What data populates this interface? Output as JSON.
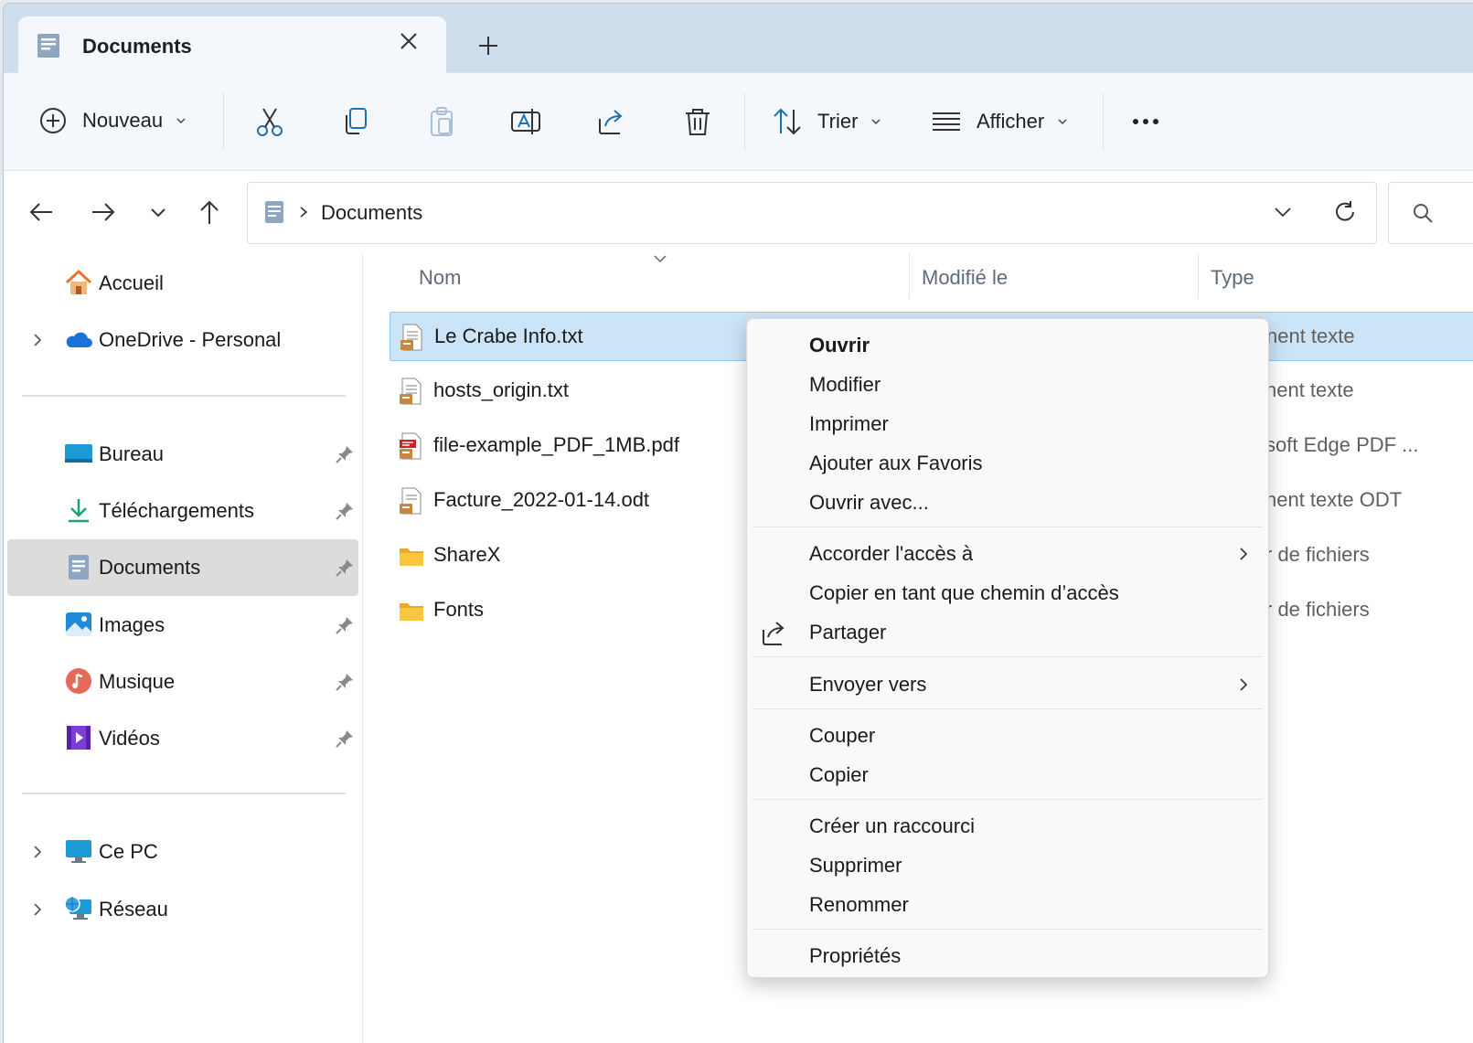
{
  "tab": {
    "title": "Documents"
  },
  "toolbar": {
    "new_label": "Nouveau",
    "sort_label": "Trier",
    "view_label": "Afficher"
  },
  "address": {
    "path": "Documents"
  },
  "sidebar": {
    "home": "Accueil",
    "onedrive": "OneDrive - Personal",
    "quick": [
      {
        "label": "Bureau",
        "icon": "desktop-icon"
      },
      {
        "label": "Téléchargements",
        "icon": "download-icon"
      },
      {
        "label": "Documents",
        "icon": "documents-icon"
      },
      {
        "label": "Images",
        "icon": "pictures-icon"
      },
      {
        "label": "Musique",
        "icon": "music-icon"
      },
      {
        "label": "Vidéos",
        "icon": "videos-icon"
      }
    ],
    "this_pc": "Ce PC",
    "network": "Réseau"
  },
  "columns": {
    "name": "Nom",
    "modified": "Modifié le",
    "type": "Type"
  },
  "files": [
    {
      "name": "Le Crabe Info.txt",
      "type": "nent texte",
      "icon": "text-file-icon"
    },
    {
      "name": "hosts_origin.txt",
      "type": "nent texte",
      "icon": "text-file-icon"
    },
    {
      "name": "file-example_PDF_1MB.pdf",
      "type": "soft Edge PDF ...",
      "icon": "pdf-file-icon"
    },
    {
      "name": "Facture_2022-01-14.odt",
      "type": "nent texte ODT",
      "icon": "odt-file-icon"
    },
    {
      "name": "ShareX",
      "type": "r de fichiers",
      "icon": "folder-icon"
    },
    {
      "name": "Fonts",
      "type": "r de fichiers",
      "icon": "folder-icon"
    }
  ],
  "context_menu": {
    "open": "Ouvrir",
    "edit": "Modifier",
    "print": "Imprimer",
    "add_favorites": "Ajouter aux Favoris",
    "open_with": "Ouvrir avec...",
    "give_access": "Accorder l'accès à",
    "copy_path": "Copier en tant que chemin d’accès",
    "share": "Partager",
    "send_to": "Envoyer vers",
    "cut": "Couper",
    "copy": "Copier",
    "create_shortcut": "Créer un raccourci",
    "delete": "Supprimer",
    "rename": "Renommer",
    "properties": "Propriétés"
  },
  "colors": {
    "accent": "#0067c0",
    "selection": "#cce4f7",
    "folder": "#f8c73b"
  }
}
